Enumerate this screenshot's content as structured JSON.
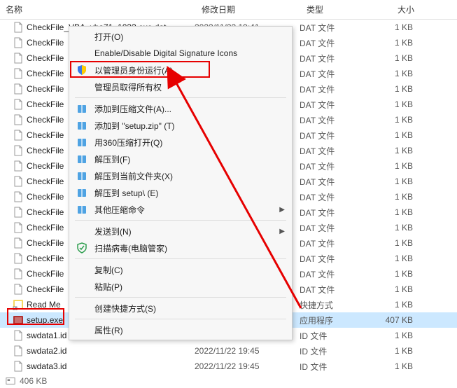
{
  "header": {
    "name": "名称",
    "date": "修改日期",
    "type": "类型",
    "size": "大小"
  },
  "rows": [
    {
      "icon": "file",
      "name": "CheckFile_VBA_vba71_1033.exe.dat",
      "date": "2022/11/22 19:41",
      "type": "DAT 文件",
      "size": "1 KB",
      "selected": false
    },
    {
      "icon": "file",
      "name": "CheckFile",
      "date": "",
      "type": "DAT 文件",
      "size": "1 KB"
    },
    {
      "icon": "file",
      "name": "CheckFile",
      "date": "",
      "type": "DAT 文件",
      "size": "1 KB"
    },
    {
      "icon": "file",
      "name": "CheckFile",
      "date": "",
      "type": "DAT 文件",
      "size": "1 KB"
    },
    {
      "icon": "file",
      "name": "CheckFile",
      "date": "",
      "type": "DAT 文件",
      "size": "1 KB"
    },
    {
      "icon": "file",
      "name": "CheckFile",
      "date": "",
      "type": "DAT 文件",
      "size": "1 KB"
    },
    {
      "icon": "file",
      "name": "CheckFile",
      "date": "",
      "type": "DAT 文件",
      "size": "1 KB"
    },
    {
      "icon": "file",
      "name": "CheckFile",
      "date": "",
      "type": "DAT 文件",
      "size": "1 KB"
    },
    {
      "icon": "file",
      "name": "CheckFile",
      "date": "",
      "type": "DAT 文件",
      "size": "1 KB"
    },
    {
      "icon": "file",
      "name": "CheckFile",
      "date": "",
      "type": "DAT 文件",
      "size": "1 KB"
    },
    {
      "icon": "file",
      "name": "CheckFile",
      "date": "",
      "type": "DAT 文件",
      "size": "1 KB"
    },
    {
      "icon": "file",
      "name": "CheckFile",
      "date": "",
      "type": "DAT 文件",
      "size": "1 KB"
    },
    {
      "icon": "file",
      "name": "CheckFile",
      "date": "",
      "type": "DAT 文件",
      "size": "1 KB"
    },
    {
      "icon": "file",
      "name": "CheckFile",
      "date": "",
      "type": "DAT 文件",
      "size": "1 KB"
    },
    {
      "icon": "file",
      "name": "CheckFile",
      "date": "",
      "type": "DAT 文件",
      "size": "1 KB"
    },
    {
      "icon": "file",
      "name": "CheckFile",
      "date": "",
      "type": "DAT 文件",
      "size": "1 KB"
    },
    {
      "icon": "file",
      "name": "CheckFile",
      "date": "",
      "type": "DAT 文件",
      "size": "1 KB"
    },
    {
      "icon": "file",
      "name": "CheckFile",
      "date": "",
      "type": "DAT 文件",
      "size": "1 KB"
    },
    {
      "icon": "shortcut",
      "name": "Read Me",
      "date": "",
      "type": "快捷方式",
      "size": "1 KB"
    },
    {
      "icon": "exe",
      "name": "setup.exe",
      "date": "",
      "type": "应用程序",
      "size": "407 KB",
      "selected": true
    },
    {
      "icon": "file",
      "name": "swdata1.id",
      "date": "2022/11/22 19:45",
      "type": "ID 文件",
      "size": "1 KB"
    },
    {
      "icon": "file",
      "name": "swdata2.id",
      "date": "2022/11/22 19:45",
      "type": "ID 文件",
      "size": "1 KB"
    },
    {
      "icon": "file",
      "name": "swdata3.id",
      "date": "2022/11/22 19:45",
      "type": "ID 文件",
      "size": "1 KB"
    }
  ],
  "status": {
    "text": "406 KB"
  },
  "menu": [
    {
      "kind": "item",
      "icon": "",
      "label": "打开(O)"
    },
    {
      "kind": "item",
      "icon": "",
      "label": "Enable/Disable Digital Signature Icons"
    },
    {
      "kind": "item",
      "icon": "shield",
      "label": "以管理员身份运行(A)",
      "highlight": true
    },
    {
      "kind": "item",
      "icon": "",
      "label": "管理员取得所有权"
    },
    {
      "kind": "sep"
    },
    {
      "kind": "item",
      "icon": "zip",
      "label": "添加到压缩文件(A)..."
    },
    {
      "kind": "item",
      "icon": "zip",
      "label": "添加到 \"setup.zip\" (T)"
    },
    {
      "kind": "item",
      "icon": "zip",
      "label": "用360压缩打开(Q)"
    },
    {
      "kind": "item",
      "icon": "zip",
      "label": "解压到(F)"
    },
    {
      "kind": "item",
      "icon": "zip",
      "label": "解压到当前文件夹(X)"
    },
    {
      "kind": "item",
      "icon": "zip",
      "label": "解压到 setup\\ (E)"
    },
    {
      "kind": "item",
      "icon": "zip",
      "label": "其他压缩命令",
      "submenu": true
    },
    {
      "kind": "sep"
    },
    {
      "kind": "item",
      "icon": "",
      "label": "发送到(N)",
      "submenu": true
    },
    {
      "kind": "item",
      "icon": "scan",
      "label": "扫描病毒(电脑管家)"
    },
    {
      "kind": "sep"
    },
    {
      "kind": "item",
      "icon": "",
      "label": "复制(C)"
    },
    {
      "kind": "item",
      "icon": "",
      "label": "粘贴(P)"
    },
    {
      "kind": "sep"
    },
    {
      "kind": "item",
      "icon": "",
      "label": "创建快捷方式(S)"
    },
    {
      "kind": "sep"
    },
    {
      "kind": "item",
      "icon": "",
      "label": "属性(R)"
    }
  ],
  "arrow_glyph": "▶",
  "highlight_color": "#e60000"
}
